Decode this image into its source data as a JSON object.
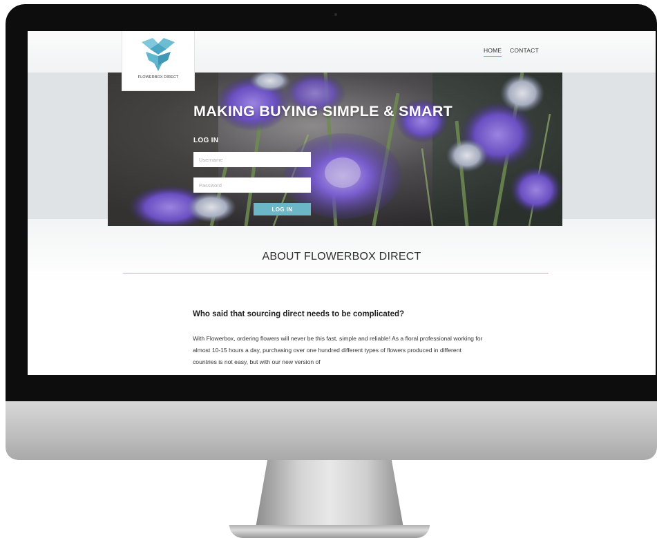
{
  "site": {
    "logo_text": "FLOWERBOX DIRECT",
    "nav": {
      "home": "HOME",
      "contact": "CONTACT"
    },
    "hero": {
      "title": "MAKING BUYING SIMPLE & SMART",
      "login_label": "LOG IN",
      "username_placeholder": "Username",
      "password_placeholder": "Password",
      "login_button": "LOG IN"
    },
    "about": {
      "title": "ABOUT FLOWERBOX DIRECT",
      "question": "Who said that sourcing direct needs to be complicated?",
      "body": "With Flowerbox, ordering flowers will never be this fast, simple and reliable! As a floral professional working for almost 10-15 hours a day, purchasing over one hundred different types of flowers produced in different countries is not easy, but with our new version of"
    }
  },
  "colors": {
    "accent": "#6bb6c7",
    "logo": "#5fb8cf",
    "hero_flowers": "#6a4fc2",
    "bezel": "#0d0d0d",
    "chin": "#c4c4c4"
  }
}
